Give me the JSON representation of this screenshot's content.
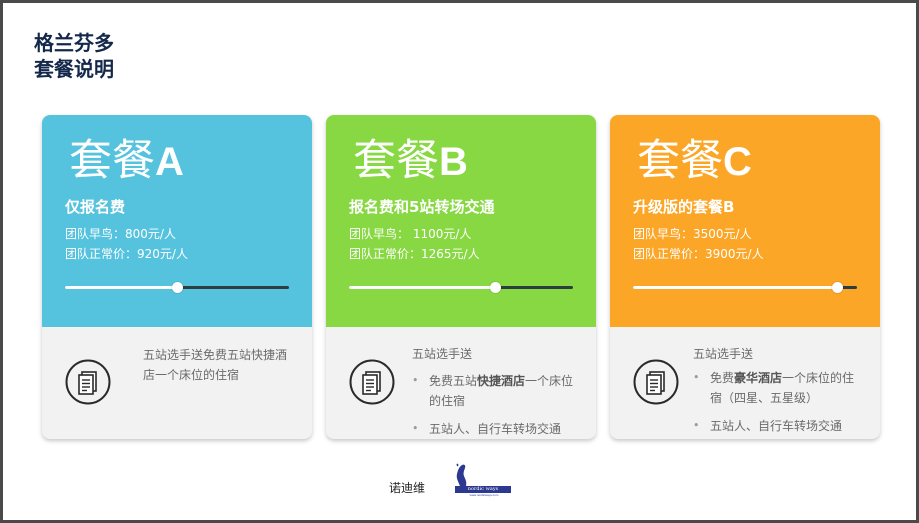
{
  "slide": {
    "title_line1": "格兰芬多",
    "title_line2": "套餐说明"
  },
  "packages": [
    {
      "name_prefix": "套餐",
      "name_letter": "A",
      "subtitle": "仅报名费",
      "price_early": "团队早鸟：800元/人",
      "price_normal": "团队正常价：920元/人",
      "slider_level": 0.5,
      "color": "#56c3de",
      "description": "五站选手送免费五站快捷酒店一个床位的住宿"
    },
    {
      "name_prefix": "套餐",
      "name_letter": "B",
      "subtitle": "报名费和5站转场交通",
      "price_early": "团队早鸟： 1100元/人",
      "price_normal": "团队正常价：1265元/人",
      "slider_level": 0.65,
      "color": "#87d843",
      "desc_head": "五站选手送",
      "bullet1_pre": "免费五站",
      "bullet1_bold": "快捷酒店",
      "bullet1_post": "一个床位的住宿",
      "bullet2": "五站人、自行车转场交通"
    },
    {
      "name_prefix": "套餐",
      "name_letter": "C",
      "subtitle": "升级版的套餐B",
      "price_early": "团队早鸟：3500元/人",
      "price_normal": "团队正常价：3900元/人",
      "slider_level": 0.91,
      "color": "#fca628",
      "desc_head": "五站选手送",
      "bullet1_pre": "免费",
      "bullet1_bold": "豪华酒店",
      "bullet1_post": "一个床位的住宿（四星、五星级）",
      "bullet2": "五站人、自行车转场交通"
    }
  ],
  "icons": {
    "document": "document-icon",
    "bullet": "•"
  },
  "footer": {
    "brand_cn": "诺迪维",
    "logo_text": "nordic ways",
    "logo_url": "www.nordicways.com",
    "logo_color": "#2b3990"
  }
}
